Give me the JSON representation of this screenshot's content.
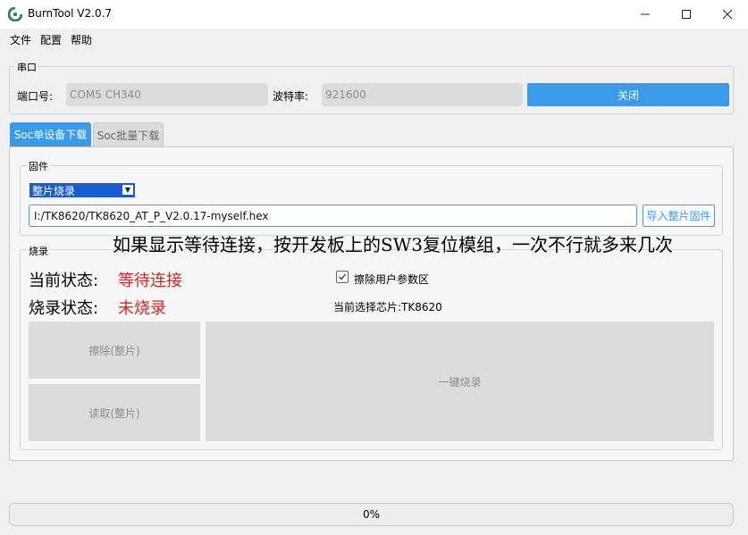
{
  "window": {
    "title": "BurnTool V2.0.7",
    "minimize_glyph": "—",
    "maximize_glyph": "☐",
    "close_glyph": "✕"
  },
  "menu": {
    "items": [
      "文件",
      "配置",
      "帮助"
    ]
  },
  "serial": {
    "group_title": "串口",
    "port_label": "端口号:",
    "port_value": "COM5  CH340",
    "baud_label": "波特率:",
    "baud_value": "921600",
    "close_button": "关闭"
  },
  "tabs": [
    {
      "label": "Soc单设备下载",
      "active": true
    },
    {
      "label": "Soc批量下载",
      "active": false
    }
  ],
  "firmware": {
    "group_title": "固件",
    "mode_selected": "整片烧录",
    "path": "I:/TK8620/TK8620_AT_P_V2.0.17-myself.hex",
    "import_button": "导入整片固件"
  },
  "burn": {
    "group_title": "烧录",
    "current_status_label": "当前状态:",
    "current_status_value": "等待连接",
    "burn_status_label": "烧录状态:",
    "burn_status_value": "未烧录",
    "erase_user_label": "擦除用户参数区",
    "erase_user_checked": true,
    "chip_label": "当前选择芯片:TK8620",
    "erase_button": "擦除(整片)",
    "read_button": "读取(整片)",
    "one_click_button": "一键烧录"
  },
  "annotation": "如果显示等待连接，按开发板上的SW3复位模组，一次不行就多来几次",
  "progress": {
    "value": 0,
    "text": "0%"
  },
  "colors": {
    "accent": "#3a9bea",
    "status_red": "#e02020"
  }
}
